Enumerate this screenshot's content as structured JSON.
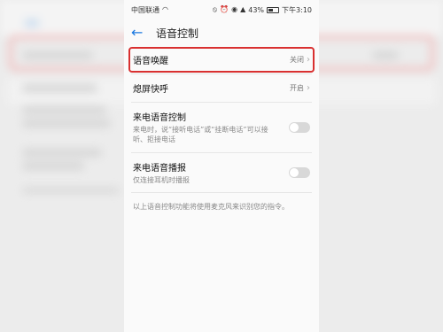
{
  "statusbar": {
    "carrier": "中国联通",
    "battery": "43%",
    "time": "下午3:10"
  },
  "header": {
    "title": "语音控制"
  },
  "items": [
    {
      "label": "语音唤醒",
      "value": "关闭"
    },
    {
      "label": "熄屏快呼",
      "value": "开启"
    },
    {
      "label": "来电语音控制",
      "sub": "来电时，说“接听电话”或“挂断电话”可以接听、拒接电话",
      "toggle": false
    },
    {
      "label": "来电语音播报",
      "sub": "仅连接耳机时播报",
      "toggle": false
    }
  ],
  "footnote": "以上语音控制功能将使用麦克风来识别您的指令。",
  "icons": [
    "back-arrow-icon",
    "chevron-right-icon",
    "signal-icon",
    "wifi-icon",
    "alarm-icon",
    "mute-icon",
    "battery-icon"
  ],
  "accent_color": "#1e7ae0",
  "highlight_color": "#d93030"
}
